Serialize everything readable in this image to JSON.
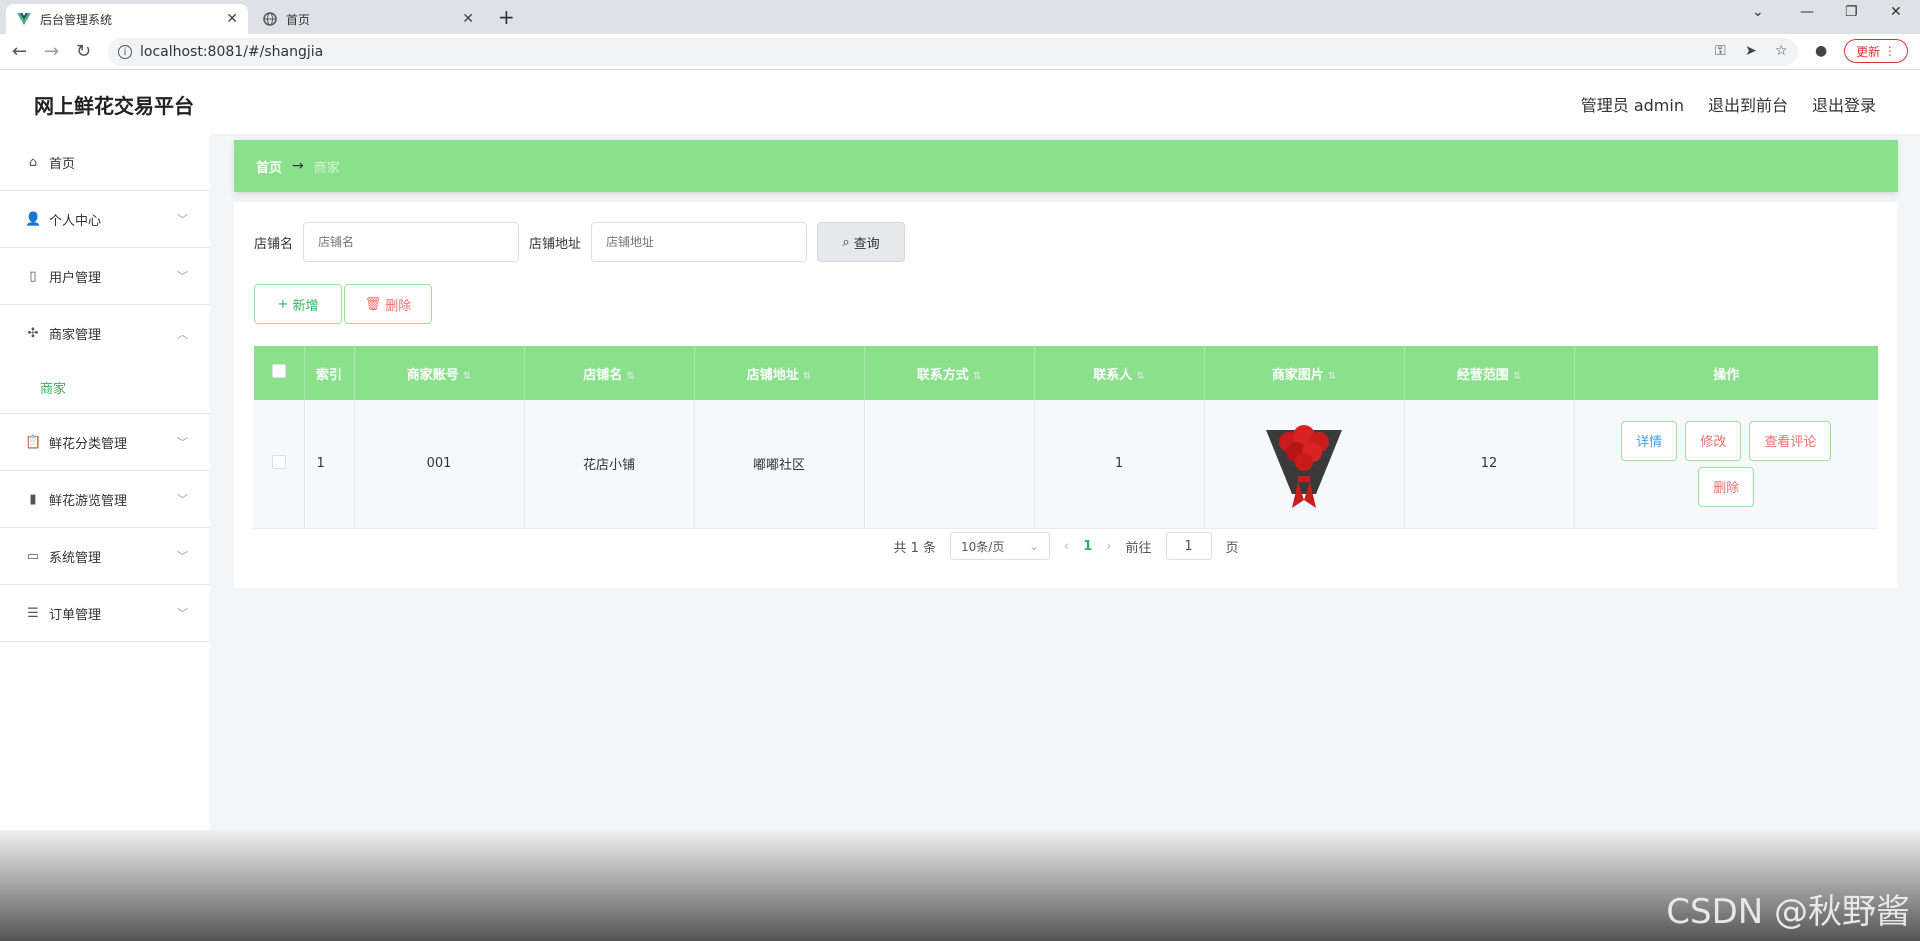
{
  "browser": {
    "tabs": [
      {
        "title": "后台管理系统",
        "active": true
      },
      {
        "title": "首页",
        "active": false
      }
    ],
    "url": "localhost:8081/#/shangjia",
    "update_label": "更新"
  },
  "header": {
    "title": "网上鲜花交易平台",
    "user": "管理员 admin",
    "to_front": "退出到前台",
    "logout": "退出登录"
  },
  "sidebar": {
    "items": [
      {
        "label": "首页",
        "icon": "home-icon"
      },
      {
        "label": "个人中心",
        "icon": "user-icon"
      },
      {
        "label": "用户管理",
        "icon": "phone-icon"
      },
      {
        "label": "商家管理",
        "icon": "compass-icon",
        "expanded": true
      },
      {
        "label": "鲜花分类管理",
        "icon": "clipboard-icon"
      },
      {
        "label": "鲜花游览管理",
        "icon": "chart-icon"
      },
      {
        "label": "系统管理",
        "icon": "monitor-icon"
      },
      {
        "label": "订单管理",
        "icon": "list-icon"
      }
    ],
    "sub_items": [
      {
        "label": "商家"
      }
    ]
  },
  "breadcrumb": {
    "home": "首页",
    "current": "商家"
  },
  "search": {
    "shop_name_label": "店铺名",
    "shop_name_placeholder": "店铺名",
    "address_label": "店铺地址",
    "address_placeholder": "店铺地址",
    "query_label": "查询"
  },
  "actions": {
    "add_label": "新增",
    "delete_label": "删除"
  },
  "table": {
    "columns": [
      "索引",
      "商家账号",
      "店铺名",
      "店铺地址",
      "联系方式",
      "联系人",
      "商家图片",
      "经营范围",
      "操作"
    ],
    "rows": [
      {
        "index": "1",
        "account": "001",
        "shop_name": "花店小铺",
        "address": "嘟嘟社区",
        "phone": "",
        "contact": "1",
        "scope": "12",
        "ops": [
          "详情",
          "修改",
          "查看评论",
          "删除"
        ]
      }
    ]
  },
  "pagination": {
    "total": "共 1 条",
    "page_size": "10条/页",
    "current_page": "1",
    "goto_label": "前往",
    "goto_value": "1",
    "page_unit": "页"
  },
  "watermark": "CSDN @秋野酱",
  "colors": {
    "accent_green": "#8be08c",
    "danger_red": "#f56c6c",
    "link_blue": "#409eff",
    "active_menu": "#2fb55f"
  }
}
